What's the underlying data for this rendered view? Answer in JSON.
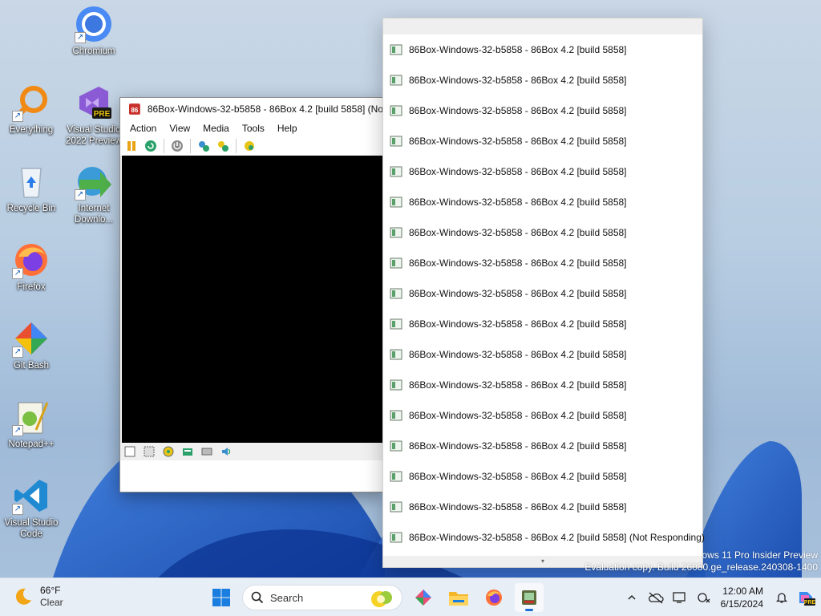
{
  "desktop": {
    "icons": [
      {
        "label": "Chromium"
      },
      {
        "label": "Everything"
      },
      {
        "label": "Visual Studio 2022 Preview",
        "badge": "PRE"
      },
      {
        "label": "Recycle Bin"
      },
      {
        "label": "Internet Downlo..."
      },
      {
        "label": "Firefox"
      },
      {
        "label": "Git Bash"
      },
      {
        "label": "Notepad++"
      },
      {
        "label": "Visual Studio Code"
      }
    ]
  },
  "vm_window": {
    "title": "86Box-Windows-32-b5858 - 86Box 4.2 [build 5858] (No",
    "menu": [
      "Action",
      "View",
      "Media",
      "Tools",
      "Help"
    ],
    "toolbar": [
      "pause-icon",
      "reset-icon",
      "power-icon",
      "settings-icon",
      "ctrl-alt-del-icon",
      "ctrl-alt-esc-icon"
    ]
  },
  "task_list": {
    "items": [
      "86Box-Windows-32-b5858 - 86Box 4.2 [build 5858]",
      "86Box-Windows-32-b5858 - 86Box 4.2 [build 5858]",
      "86Box-Windows-32-b5858 - 86Box 4.2 [build 5858]",
      "86Box-Windows-32-b5858 - 86Box 4.2 [build 5858]",
      "86Box-Windows-32-b5858 - 86Box 4.2 [build 5858]",
      "86Box-Windows-32-b5858 - 86Box 4.2 [build 5858]",
      "86Box-Windows-32-b5858 - 86Box 4.2 [build 5858]",
      "86Box-Windows-32-b5858 - 86Box 4.2 [build 5858]",
      "86Box-Windows-32-b5858 - 86Box 4.2 [build 5858]",
      "86Box-Windows-32-b5858 - 86Box 4.2 [build 5858]",
      "86Box-Windows-32-b5858 - 86Box 4.2 [build 5858]",
      "86Box-Windows-32-b5858 - 86Box 4.2 [build 5858]",
      "86Box-Windows-32-b5858 - 86Box 4.2 [build 5858]",
      "86Box-Windows-32-b5858 - 86Box 4.2 [build 5858]",
      "86Box-Windows-32-b5858 - 86Box 4.2 [build 5858]",
      "86Box-Windows-32-b5858 - 86Box 4.2 [build 5858]",
      "86Box-Windows-32-b5858 - 86Box 4.2 [build 5858] (Not Responding)"
    ]
  },
  "watermark": {
    "line1": "ows 11 Pro Insider Preview",
    "line2": "Evaluation copy. Build 26080.ge_release.240308-1400"
  },
  "taskbar": {
    "weather_temp": "66°F",
    "weather_cond": "Clear",
    "search_label": "Search",
    "time": "12:00 AM",
    "date": "6/15/2024"
  }
}
